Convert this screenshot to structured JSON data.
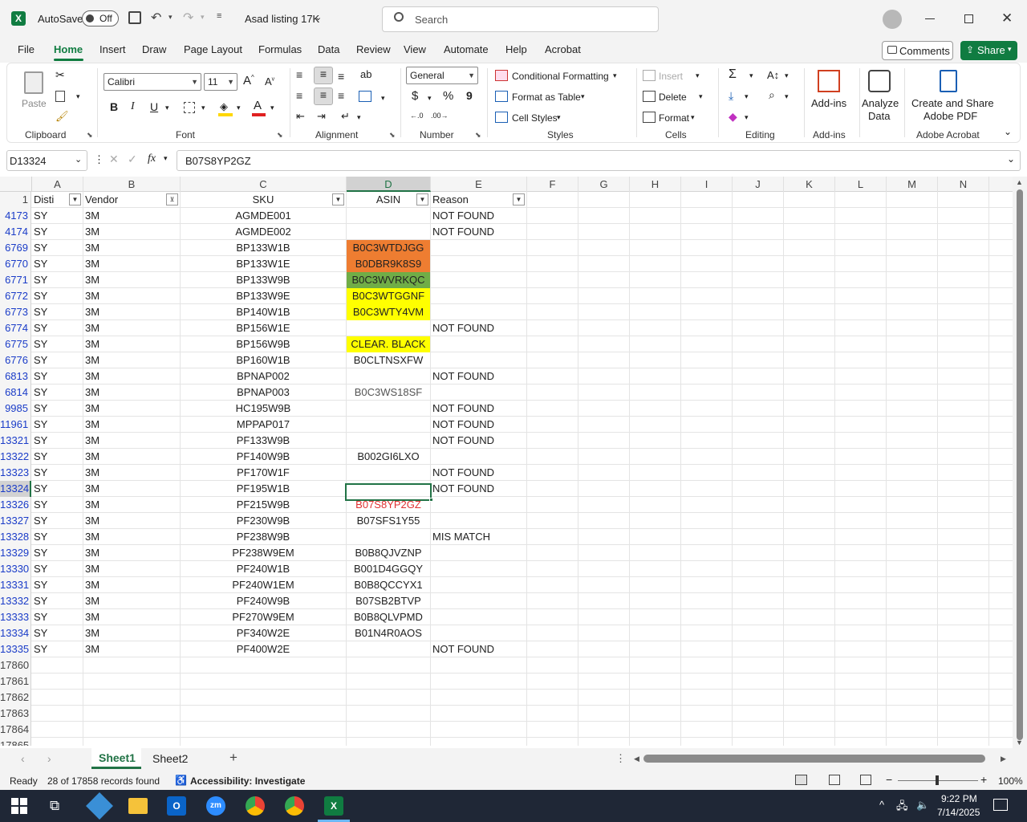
{
  "titlebar": {
    "autosave_label": "AutoSave",
    "autosave_state": "Off",
    "file_name": "Asad listing 17K",
    "search_placeholder": "Search"
  },
  "menu": {
    "file": "File",
    "home": "Home",
    "insert": "Insert",
    "draw": "Draw",
    "page_layout": "Page Layout",
    "formulas": "Formulas",
    "data": "Data",
    "review": "Review",
    "view": "View",
    "automate": "Automate",
    "help": "Help",
    "acrobat": "Acrobat",
    "comments": "Comments",
    "share": "Share"
  },
  "ribbon": {
    "clipboard": {
      "paste": "Paste",
      "label": "Clipboard"
    },
    "font": {
      "name": "Calibri",
      "size": "11",
      "bold": "B",
      "italic": "I",
      "underline": "U",
      "label": "Font"
    },
    "alignment": {
      "label": "Alignment"
    },
    "number": {
      "format": "General",
      "currency": "$",
      "percent": "%",
      "comma": "9",
      "label": "Number"
    },
    "styles": {
      "conditional": "Conditional Formatting",
      "format_table": "Format as Table",
      "cell_styles": "Cell Styles",
      "label": "Styles"
    },
    "cells": {
      "insert": "Insert",
      "delete": "Delete",
      "format": "Format",
      "label": "Cells"
    },
    "editing": {
      "label": "Editing"
    },
    "addins": {
      "addins": "Add-ins",
      "label": "Add-ins"
    },
    "analyze": {
      "line1": "Analyze",
      "line2": "Data"
    },
    "acrobat": {
      "line1": "Create and Share",
      "line2": "Adobe PDF",
      "label": "Adobe Acrobat"
    }
  },
  "formula_bar": {
    "name_box": "D13324",
    "fx": "fx",
    "content": "B07S8YP2GZ"
  },
  "columns": [
    "A",
    "B",
    "C",
    "D",
    "E",
    "F",
    "G",
    "H",
    "I",
    "J",
    "K",
    "L",
    "M",
    "N"
  ],
  "header_row": {
    "num": "1",
    "disti": "Disti",
    "vendor": "Vendor",
    "sku": "SKU",
    "asin": "ASIN",
    "reason": "Reason"
  },
  "rows": [
    {
      "num": "4173",
      "disti": "SY",
      "vendor": "3M",
      "sku": "AGMDE001",
      "asin": "",
      "reason": "NOT FOUND"
    },
    {
      "num": "4174",
      "disti": "SY",
      "vendor": "3M",
      "sku": "AGMDE002",
      "asin": "",
      "reason": "NOT FOUND"
    },
    {
      "num": "6769",
      "disti": "SY",
      "vendor": "3M",
      "sku": "BP133W1B",
      "asin": "B0C3WTDJGG",
      "reason": "",
      "fill": "#ee7d31"
    },
    {
      "num": "6770",
      "disti": "SY",
      "vendor": "3M",
      "sku": "BP133W1E",
      "asin": "B0DBR9K8S9",
      "reason": "",
      "fill": "#ee7d31"
    },
    {
      "num": "6771",
      "disti": "SY",
      "vendor": "3M",
      "sku": "BP133W9B",
      "asin": "B0C3WVRKQC",
      "reason": "",
      "fill": "#70ad47"
    },
    {
      "num": "6772",
      "disti": "SY",
      "vendor": "3M",
      "sku": "BP133W9E",
      "asin": "B0C3WTGGNF",
      "reason": "",
      "fill": "#ffff00"
    },
    {
      "num": "6773",
      "disti": "SY",
      "vendor": "3M",
      "sku": "BP140W1B",
      "asin": "B0C3WTY4VM",
      "reason": "",
      "fill": "#ffff00"
    },
    {
      "num": "6774",
      "disti": "SY",
      "vendor": "3M",
      "sku": "BP156W1E",
      "asin": "",
      "reason": "NOT FOUND"
    },
    {
      "num": "6775",
      "disti": "SY",
      "vendor": "3M",
      "sku": "BP156W9B",
      "asin": "CLEAR. BLACK",
      "reason": "",
      "fill": "#ffff00"
    },
    {
      "num": "6776",
      "disti": "SY",
      "vendor": "3M",
      "sku": "BP160W1B",
      "asin": "B0CLTNSXFW",
      "reason": ""
    },
    {
      "num": "6813",
      "disti": "SY",
      "vendor": "3M",
      "sku": "BPNAP002",
      "asin": "",
      "reason": "NOT FOUND"
    },
    {
      "num": "6814",
      "disti": "SY",
      "vendor": "3M",
      "sku": "BPNAP003",
      "asin": "B0C3WS18SF",
      "reason": "",
      "color": "#555555"
    },
    {
      "num": "9985",
      "disti": "SY",
      "vendor": "3M",
      "sku": "HC195W9B",
      "asin": "",
      "reason": "NOT FOUND"
    },
    {
      "num": "11961",
      "disti": "SY",
      "vendor": "3M",
      "sku": "MPPAP017",
      "asin": "",
      "reason": "NOT FOUND"
    },
    {
      "num": "13321",
      "disti": "SY",
      "vendor": "3M",
      "sku": "PF133W9B",
      "asin": "",
      "reason": "NOT FOUND"
    },
    {
      "num": "13322",
      "disti": "SY",
      "vendor": "3M",
      "sku": "PF140W9B",
      "asin": "B002GI6LXO",
      "reason": ""
    },
    {
      "num": "13323",
      "disti": "SY",
      "vendor": "3M",
      "sku": "PF170W1F",
      "asin": "",
      "reason": "NOT FOUND"
    },
    {
      "num": "13324",
      "disti": "SY",
      "vendor": "3M",
      "sku": "PF195W1B",
      "asin": "",
      "reason": "NOT FOUND",
      "selected": true
    },
    {
      "num": "13326",
      "disti": "SY",
      "vendor": "3M",
      "sku": "PF215W9B",
      "asin": "B07S8YP2GZ",
      "reason": "",
      "color": "#e03030"
    },
    {
      "num": "13327",
      "disti": "SY",
      "vendor": "3M",
      "sku": "PF230W9B",
      "asin": "B07SFS1Y55",
      "reason": ""
    },
    {
      "num": "13328",
      "disti": "SY",
      "vendor": "3M",
      "sku": "PF238W9B",
      "asin": "",
      "reason": "MIS MATCH"
    },
    {
      "num": "13329",
      "disti": "SY",
      "vendor": "3M",
      "sku": "PF238W9EM",
      "asin": "B0B8QJVZNP",
      "reason": ""
    },
    {
      "num": "13330",
      "disti": "SY",
      "vendor": "3M",
      "sku": "PF240W1B",
      "asin": "B001D4GGQY",
      "reason": ""
    },
    {
      "num": "13331",
      "disti": "SY",
      "vendor": "3M",
      "sku": "PF240W1EM",
      "asin": "B0B8QCCYX1",
      "reason": ""
    },
    {
      "num": "13332",
      "disti": "SY",
      "vendor": "3M",
      "sku": "PF240W9B",
      "asin": "B07SB2BTVP",
      "reason": ""
    },
    {
      "num": "13333",
      "disti": "SY",
      "vendor": "3M",
      "sku": "PF270W9EM",
      "asin": "B0B8QLVPMD",
      "reason": ""
    },
    {
      "num": "13334",
      "disti": "SY",
      "vendor": "3M",
      "sku": "PF340W2E",
      "asin": "B01N4R0AOS",
      "reason": ""
    },
    {
      "num": "13335",
      "disti": "SY",
      "vendor": "3M",
      "sku": "PF400W2E",
      "asin": "",
      "reason": "NOT FOUND"
    }
  ],
  "empty_rows": [
    "17860",
    "17861",
    "17862",
    "17863",
    "17864",
    "17865"
  ],
  "sheets": [
    "Sheet1",
    "Sheet2"
  ],
  "status": {
    "ready": "Ready",
    "records": "28 of 17858 records found",
    "accessibility": "Accessibility: Investigate",
    "zoom": "100%"
  },
  "taskbar": {
    "time": "9:22 PM",
    "date": "7/14/2025"
  },
  "colors": {
    "excel_green": "#107c41",
    "selection": "#217346",
    "row_filtered_blue": "#1a3cc8"
  }
}
